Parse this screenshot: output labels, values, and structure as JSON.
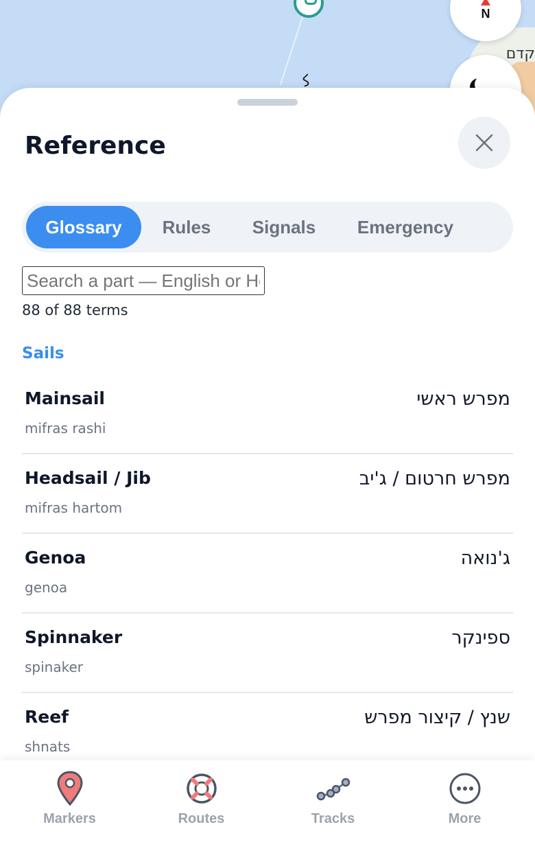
{
  "map": {
    "compass_label": "N",
    "place_label": "קדם",
    "road_glyph": "ﻛ"
  },
  "sheet": {
    "title": "Reference",
    "tabs": [
      {
        "label": "Glossary",
        "active": true
      },
      {
        "label": "Rules",
        "active": false
      },
      {
        "label": "Signals",
        "active": false
      },
      {
        "label": "Emergency",
        "active": false
      }
    ],
    "search": {
      "placeholder": "Search a part — English or Hebrew",
      "value": ""
    },
    "count": "88 of 88 terms",
    "section": "Sails",
    "terms": [
      {
        "english": "Mainsail",
        "translit": "mifras rashi",
        "hebrew": "מפרש ראשי"
      },
      {
        "english": "Headsail / Jib",
        "translit": "mifras hartom",
        "hebrew": "מפרש חרטום / ג'יב"
      },
      {
        "english": "Genoa",
        "translit": "genoa",
        "hebrew": "ג'נואה"
      },
      {
        "english": "Spinnaker",
        "translit": "spinaker",
        "hebrew": "ספינקר"
      },
      {
        "english": "Reef",
        "translit": "shnats",
        "hebrew": "שנץ / קיצור מפרש"
      }
    ]
  },
  "bottom_nav": [
    {
      "label": "Markers",
      "icon": "marker-pin-icon"
    },
    {
      "label": "Routes",
      "icon": "lifebuoy-icon"
    },
    {
      "label": "Tracks",
      "icon": "tracks-icon"
    },
    {
      "label": "More",
      "icon": "more-dots-icon"
    }
  ],
  "colors": {
    "accent": "#3b8def",
    "marker_pin": "#ef7b7b",
    "text_dark": "#0f172a",
    "text_muted": "#6b7280",
    "nav_inactive": "#9aa3ae",
    "map_water": "#c5dcf7"
  }
}
